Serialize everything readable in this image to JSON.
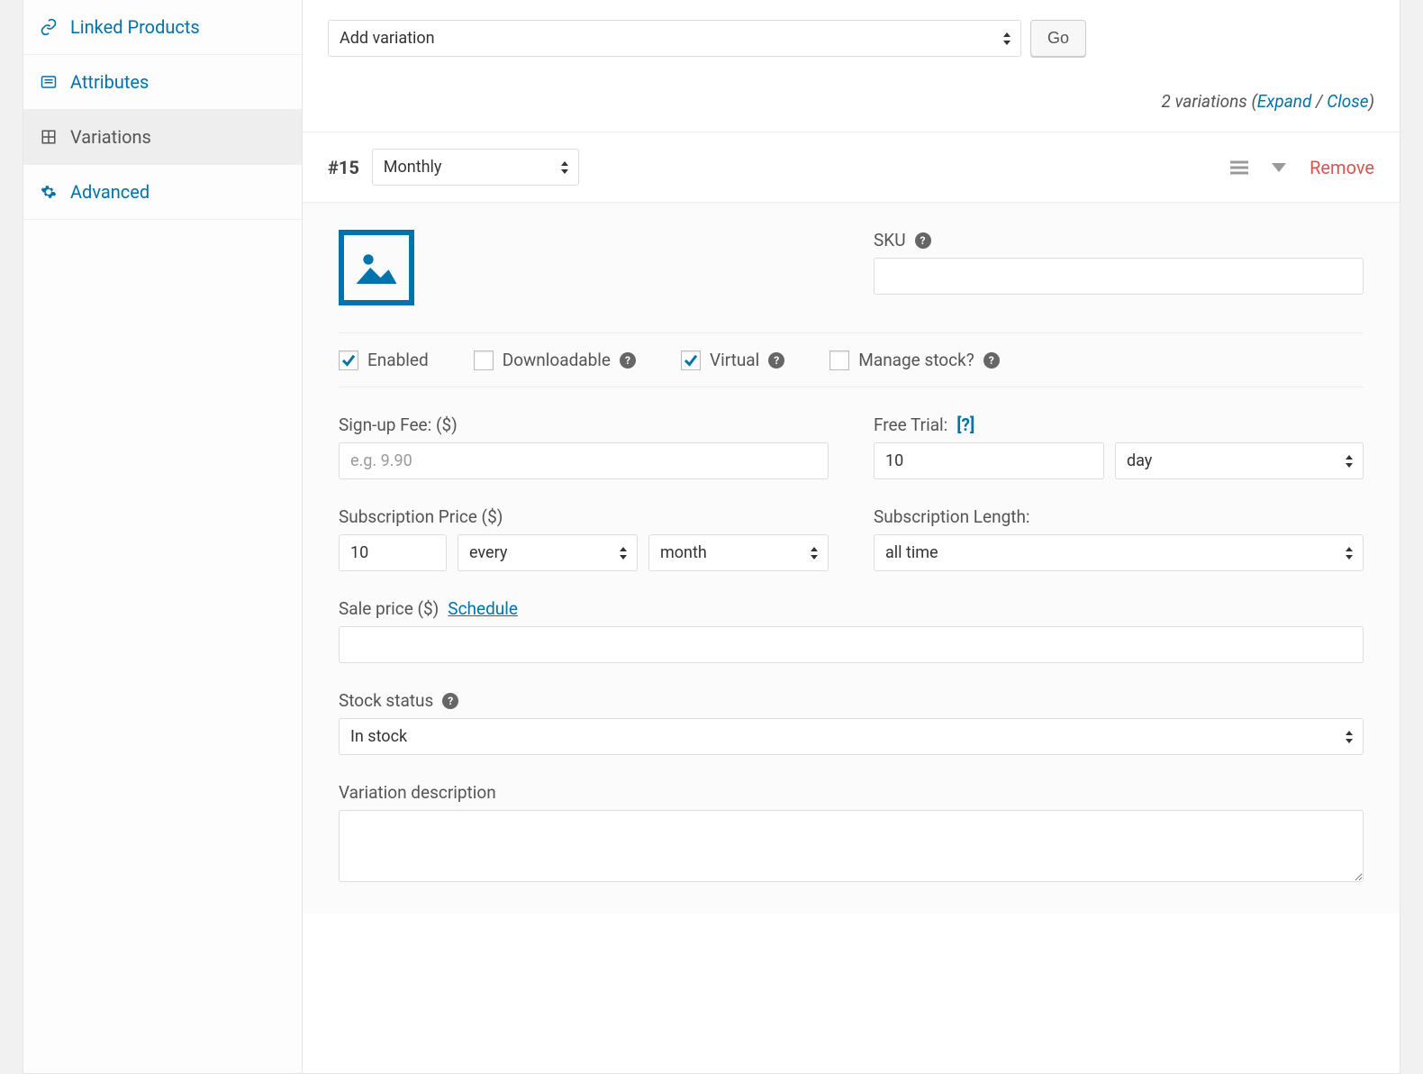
{
  "sidebar": {
    "items": [
      {
        "label": "Linked Products"
      },
      {
        "label": "Attributes"
      },
      {
        "label": "Variations"
      },
      {
        "label": "Advanced"
      }
    ]
  },
  "toolbar": {
    "add_variation": "Add variation",
    "go_label": "Go",
    "count_text": "2 variations (",
    "expand": "Expand",
    "separator": " / ",
    "close": "Close",
    "closing_paren": ")"
  },
  "variation": {
    "id_label": "#15",
    "attribute_value": "Monthly",
    "remove_label": "Remove",
    "sku_label": "SKU",
    "sku_value": "",
    "checks": {
      "enabled": {
        "label": "Enabled",
        "checked": true,
        "help": false
      },
      "downloadable": {
        "label": "Downloadable",
        "checked": false,
        "help": true
      },
      "virtual": {
        "label": "Virtual",
        "checked": true,
        "help": true
      },
      "manage_stock": {
        "label": "Manage stock?",
        "checked": false,
        "help": true
      }
    },
    "signup_fee": {
      "label": "Sign-up Fee: ($)",
      "placeholder": "e.g. 9.90",
      "value": ""
    },
    "free_trial": {
      "label": "Free Trial: ",
      "help_link": "[?]",
      "value": "10",
      "unit": "day"
    },
    "subscription_price": {
      "label": "Subscription Price ($)",
      "value": "10",
      "interval": "every",
      "period": "month"
    },
    "subscription_length": {
      "label": "Subscription Length:",
      "value": "all time"
    },
    "sale_price": {
      "label": "Sale price ($) ",
      "schedule": "Schedule",
      "value": ""
    },
    "stock_status": {
      "label": "Stock status",
      "value": "In stock"
    },
    "description": {
      "label": "Variation description",
      "value": ""
    }
  }
}
